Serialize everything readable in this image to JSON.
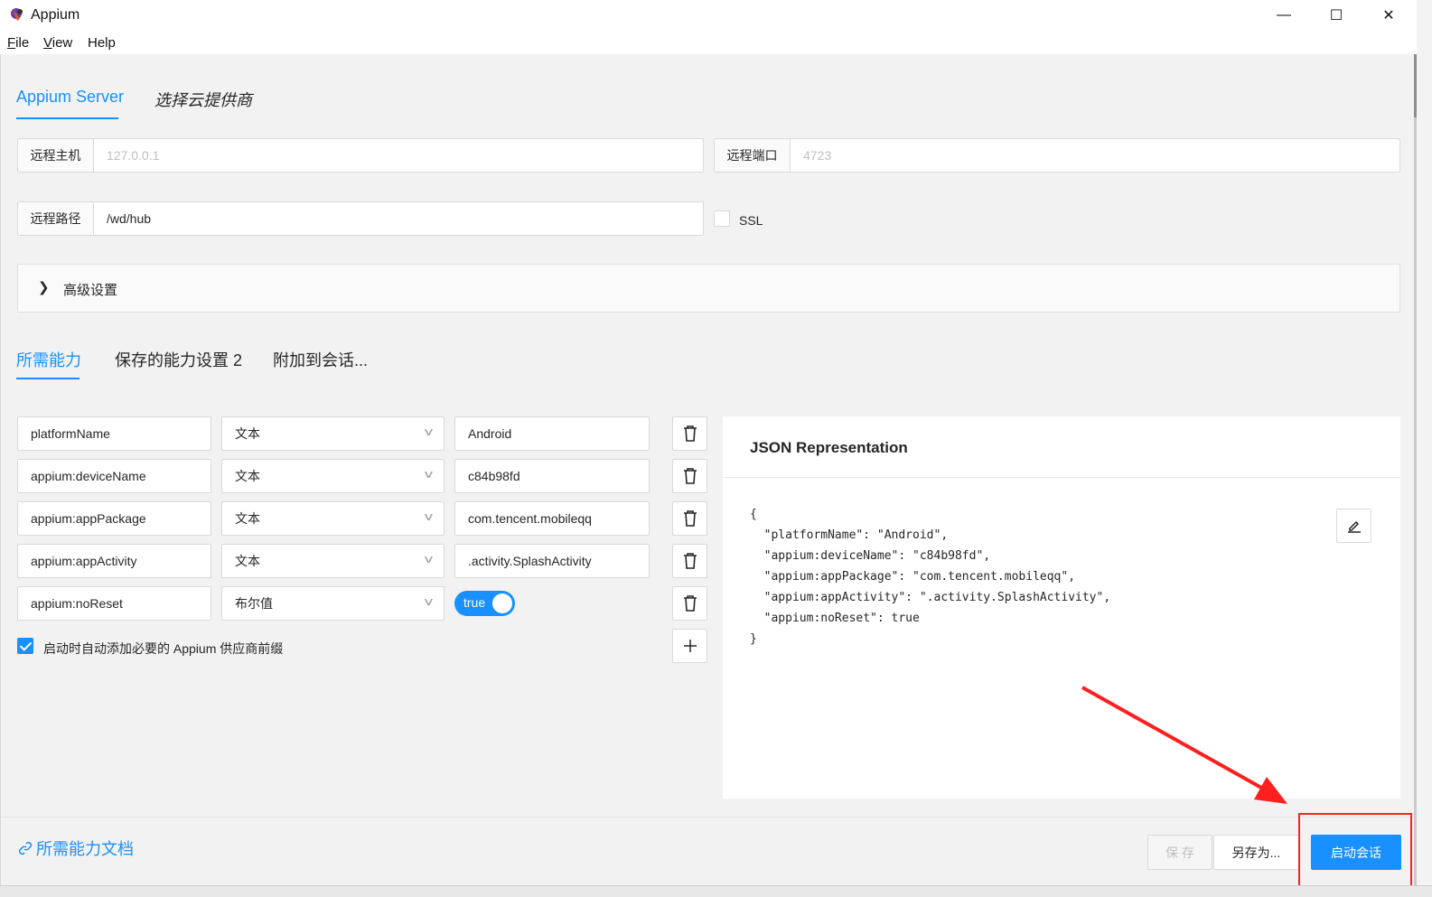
{
  "window": {
    "title": "Appium",
    "controls": {
      "minimize": "—",
      "maximize": "☐",
      "close": "✕"
    }
  },
  "menu": [
    {
      "key": "F",
      "rest": "ile"
    },
    {
      "key": "V",
      "rest": "iew"
    },
    {
      "key": "H",
      "rest": "elp"
    }
  ],
  "server_tabs": [
    "Appium Server",
    "选择云提供商"
  ],
  "server": {
    "host_label": "远程主机",
    "host_placeholder": "127.0.0.1",
    "port_label": "远程端口",
    "port_placeholder": "4723",
    "path_label": "远程路径",
    "path_value": "/wd/hub",
    "ssl_label": "SSL",
    "advanced_label": "高级设置"
  },
  "cap_tabs": [
    "所需能力",
    "保存的能力设置 2",
    "附加到会话..."
  ],
  "capabilities": [
    {
      "name": "platformName",
      "type": "文本",
      "value": "Android"
    },
    {
      "name": "appium:deviceName",
      "type": "文本",
      "value": "c84b98fd"
    },
    {
      "name": "appium:appPackage",
      "type": "文本",
      "value": "com.tencent.mobileqq"
    },
    {
      "name": "appium:appActivity",
      "type": "文本",
      "value": ".activity.SplashActivity"
    },
    {
      "name": "appium:noReset",
      "type": "布尔值",
      "value": "true"
    }
  ],
  "auto_prefix_label": "启动时自动添加必要的 Appium 供应商前缀",
  "json_panel": {
    "title": "JSON Representation",
    "code": "{\n  \"platformName\": \"Android\",\n  \"appium:deviceName\": \"c84b98fd\",\n  \"appium:appPackage\": \"com.tencent.mobileqq\",\n  \"appium:appActivity\": \".activity.SplashActivity\",\n  \"appium:noReset\": true\n}"
  },
  "footer": {
    "docs_link": "所需能力文档",
    "save": "保 存",
    "save_as": "另存为...",
    "start": "启动会话"
  },
  "colors": {
    "accent": "#1890ff",
    "annotation": "#ff1f1f"
  }
}
